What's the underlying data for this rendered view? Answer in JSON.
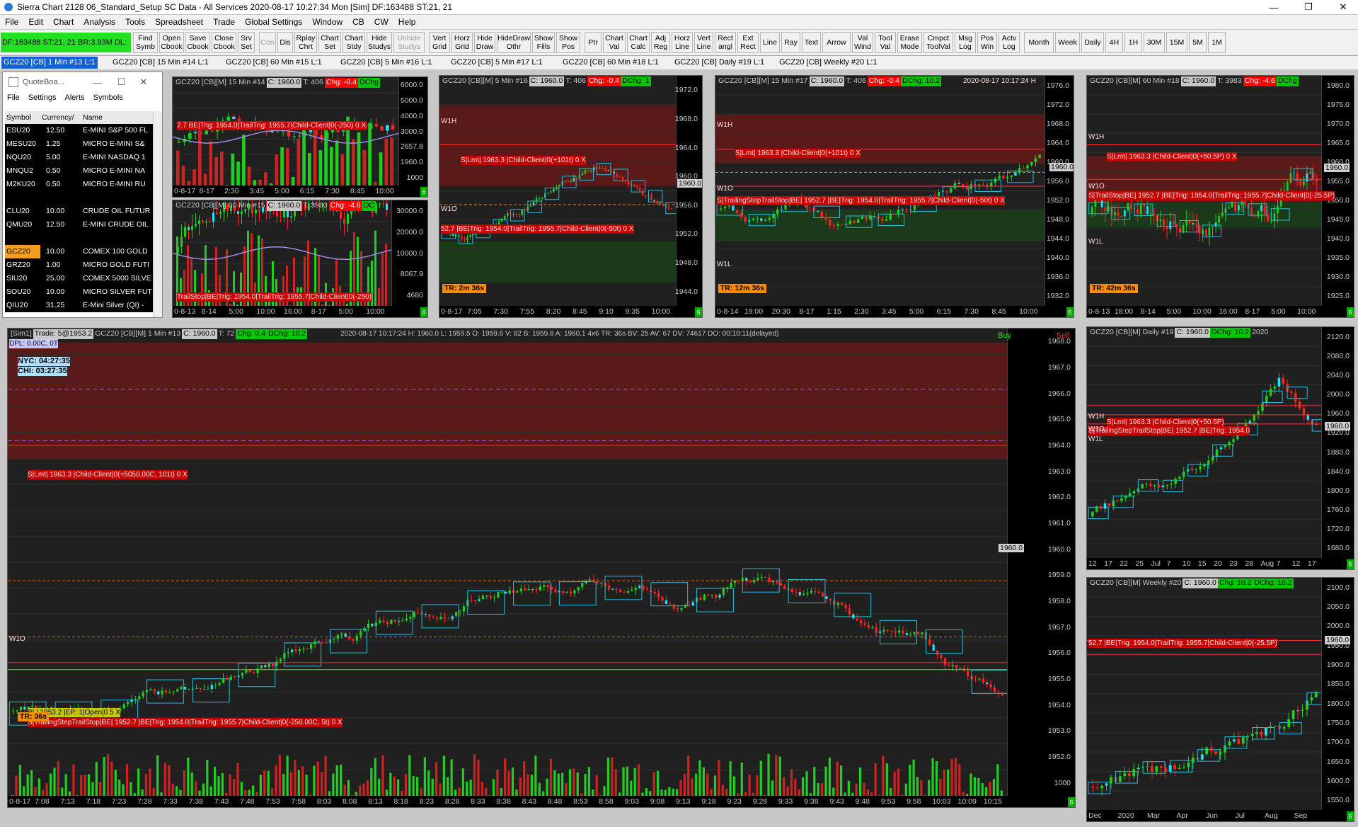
{
  "window": {
    "title": "Sierra Chart 2128 06_Standard_Setup  SC Data - All Services 2020-08-17  10:27:34 Mon [Sim]  DF:163488  ST:21, 21",
    "minimize": "—",
    "restore": "❐",
    "close": "✕"
  },
  "menu": [
    "File",
    "Edit",
    "Chart",
    "Analysis",
    "Tools",
    "Spreadsheet",
    "Trade",
    "Global Settings",
    "Window",
    "CB",
    "CW",
    "Help"
  ],
  "toolbar": {
    "status": "DF:163488  ST:21, 21  BR:3.93M  DL:",
    "buttons": [
      {
        "label": "Find\nSymb"
      },
      {
        "label": "Open\nCbook"
      },
      {
        "label": "Save\nCbook"
      },
      {
        "label": "Close\nCbook"
      },
      {
        "label": "Srv\nSet"
      },
      {
        "label": "Con",
        "disabled": true
      },
      {
        "label": "Dis"
      },
      {
        "label": "Rplay\nChrt"
      },
      {
        "label": "Chart\nSet"
      },
      {
        "label": "Chart\nStdy"
      },
      {
        "label": "Hide\nStudys"
      },
      {
        "label": "Unhide\nStudys",
        "disabled": true
      },
      {
        "label": "Vert\nGrid"
      },
      {
        "label": "Horz\nGrid"
      },
      {
        "label": "Hide\nDraw"
      },
      {
        "label": "HideDraw\nOthr"
      },
      {
        "label": "Show\nFills"
      },
      {
        "label": "Show\nPos"
      },
      {
        "label": "Ptr"
      },
      {
        "label": "Chart\nVal"
      },
      {
        "label": "Chart\nCalc"
      },
      {
        "label": "Adj\nReg"
      },
      {
        "label": "Horz\nLine"
      },
      {
        "label": "Vert\nLine"
      },
      {
        "label": "Rect\nangl"
      },
      {
        "label": "Ext\nRect"
      },
      {
        "label": "Line"
      },
      {
        "label": "Ray"
      },
      {
        "label": "Text"
      },
      {
        "label": "Arrow"
      },
      {
        "label": "Val\nWind"
      },
      {
        "label": "Tool\nVal"
      },
      {
        "label": "Erase\nMode"
      },
      {
        "label": "Cmpct\nToolVal"
      },
      {
        "label": "Msg\nLog"
      },
      {
        "label": "Pos\nWin"
      },
      {
        "label": "Actv\nLog"
      },
      {
        "label": "Month"
      },
      {
        "label": "Week"
      },
      {
        "label": "Daily"
      },
      {
        "label": "4H"
      },
      {
        "label": "1H"
      },
      {
        "label": "30M"
      },
      {
        "label": "15M"
      },
      {
        "label": "5M"
      },
      {
        "label": "1M"
      }
    ]
  },
  "tabs": [
    "GCZ20 [CB]  1 Min  #13  L:1",
    "GCZ20 [CB]  15 Min  #14  L:1",
    "GCZ20 [CB]  60 Min  #15  L:1",
    "GCZ20 [CB]  5 Min  #16  L:1",
    "GCZ20 [CB]  5 Min  #17  L:1",
    "GCZ20 [CB]  60 Min  #18  L:1",
    "GCZ20 [CB]  Daily  #19  L:1",
    "GCZ20 [CB]  Weekly  #20  L:1"
  ],
  "quoteboard": {
    "title": "QuoteBoa...",
    "menu": [
      "File",
      "Settings",
      "Alerts",
      "Symbols"
    ],
    "headers": [
      "Symbol",
      "Currency/",
      "Name"
    ],
    "rows": [
      [
        "ESU20",
        "12.50",
        "E-MINI S&P 500 FL"
      ],
      [
        "MESU20",
        "1.25",
        "MICRO E-MINI S&"
      ],
      [
        "NQU20",
        "5.00",
        "E-MINI NASDAQ 1"
      ],
      [
        "MNQU2",
        "0.50",
        "MICRO E-MINI NA"
      ],
      [
        "M2KU20",
        "0.50",
        "MICRO E-MINI RU"
      ],
      [
        "",
        "",
        " "
      ],
      [
        "CLU20",
        "10.00",
        "CRUDE OIL FUTUR"
      ],
      [
        "QMU20",
        "12.50",
        "E-MINI CRUDE OIL"
      ],
      [
        "",
        "",
        " "
      ],
      [
        "GCZ20",
        "10.00",
        "COMEX 100 GOLD"
      ],
      [
        "GRZ20",
        "1.00",
        "MICRO GOLD FUTI"
      ],
      [
        "SIU20",
        "25.00",
        "COMEX 5000 SILVE"
      ],
      [
        "SOU20",
        "10.00",
        "MICRO SILVER FUT"
      ],
      [
        "QIU20",
        "31.25",
        "E-Mini Silver (QI) -"
      ]
    ]
  },
  "charts": {
    "c14": {
      "header": [
        "GCZ20 [CB][M]  15 Min  #14",
        "C: 1960.0",
        "T: 406",
        "Chg: -0.4",
        "DChg"
      ],
      "yticks": [
        "6000.0",
        "5000.0",
        "4000.0",
        "3000.0",
        "2657.8",
        "1960.0",
        "1000"
      ],
      "xticks": [
        "0-8-17",
        "8-17",
        "2:30",
        "3:45",
        "5:00",
        "6:15",
        "7:30",
        "8:45",
        "10:00"
      ],
      "order": "2.7 BE|Trig: 1954.0|TrailTrig: 1955.7|Child-Client|0(-250)  0  X",
      "cur": "1960.0"
    },
    "c15": {
      "header": [
        "GCZ20 [CB][M]  60 Min  #15",
        "C: 1960.0",
        "T: 3983",
        "Chg: -4.6",
        "DC"
      ],
      "yticks": [
        "30000.0",
        "20000.0",
        "10000.0",
        "8067.9",
        "4680"
      ],
      "xticks": [
        "0-8-13",
        "8-14",
        "5:00",
        "10:00",
        "16:00",
        "8-17",
        "5:00",
        "10:00"
      ],
      "order": "TrailStop|BE|Trig: 1954.0|TrailTrig: 1955.7|Child-Client|0(-250)"
    },
    "c16": {
      "header": [
        "GCZ20 [CB][M]  5 Min  #16",
        "C: 1960.0",
        "T: 406",
        "Chg: -0.4",
        "DChg: 1"
      ],
      "yticks": [
        "1972.0",
        "1968.0",
        "1964.0",
        "1960.0",
        "1956.0",
        "1952.0",
        "1948.0",
        "1944.0"
      ],
      "xticks": [
        "0-8-17",
        "7:05",
        "7:30",
        "7:55",
        "8:20",
        "8:45",
        "9:10",
        "9:35",
        "10:00"
      ],
      "order1": "S|Lmt| 1963.3 |Child-Client|0(+101t)  0  X",
      "order2": "52.7 |BE|Trig: 1954.0|TrailTrig: 1955.7|Child-Client|0(-50t)  0  X",
      "w1h": "W1H",
      "w1o": "W1O",
      "badge": "TR: 2m 36s",
      "cur": "1960.0"
    },
    "c17": {
      "header": [
        "GCZ20 [CB][M]  15 Min  #17",
        "C: 1960.0",
        "T: 406",
        "Chg: -0.4",
        "DChg: 10.2"
      ],
      "ts": "2020-08-17 10:17:24 H",
      "yticks": [
        "1976.0",
        "1972.0",
        "1968.0",
        "1964.0",
        "1960.0",
        "1956.0",
        "1952.0",
        "1948.0",
        "1944.0",
        "1940.0",
        "1936.0",
        "1932.0"
      ],
      "xticks": [
        "0-8-14",
        "19:00",
        "20:30",
        "8-17",
        "1:15",
        "2:30",
        "3:45",
        "5:00",
        "6:15",
        "7:30",
        "8:45",
        "10:00"
      ],
      "order1": "S|Lmt| 1963.3 |Child-Client|0(+101t)  0  X",
      "order2": "S|TrailingStepTrailStop|BE| 1952.7 |BE|Trig: 1954.0|TrailTrig: 1955.7|Child-Client|0(-50t)  0  X",
      "w1h": "W1H",
      "w1o": "W1O",
      "w1l": "W1L",
      "badge": "TR: 12m 36s",
      "cur": "1960.0"
    },
    "c18": {
      "header": [
        "GCZ20 [CB][M]  60 Min  #18",
        "C: 1960.0",
        "T: 3983",
        "Chg: -4.6",
        "DChg"
      ],
      "yticks": [
        "1980.0",
        "1975.0",
        "1970.0",
        "1965.0",
        "1960.0",
        "1955.0",
        "1950.0",
        "1945.0",
        "1940.0",
        "1935.0",
        "1930.0",
        "1925.0"
      ],
      "xticks": [
        "0-8-13",
        "18:00",
        "8-14",
        "5:00",
        "10:00",
        "16:00",
        "8-17",
        "5:00",
        "10:00"
      ],
      "order1": "S|Lmt| 1963.3 |Child-Client|0(+50.5P)  0  X",
      "order2": "S|TrailStop|BE| 1952.7 |BE|Trig: 1954.0|TrailTrig: 1955.7|Child-Client|0(-25.5P)",
      "w1h": "W1H",
      "w1o": "W1O",
      "w1l": "W1L",
      "badge": "TR: 42m 36s",
      "cur": "1960.0"
    },
    "c13": {
      "header": [
        "[Sim1]",
        "Trade: 5@1953.2",
        "GCZ20 [CB][M]  1 Min  #13",
        "C: 1960.0",
        "T: 72",
        "Chg: 0.4",
        "DChg: 10.2"
      ],
      "info": "2020-08-17 10:17:24  H: 1960.0  L: 1959.5  O: 1959.6  V: 82  B: 1959.8  A: 1960.1  4x6  TR: 36s  BV: 25  AV: 67  DV: 74617  DO: 00:10:11(delayed)",
      "dpl": "DPL: 0.00C, 0T",
      "nyc": "NYC: 04:27:35",
      "chi": "CHI: 03:27:35",
      "buy": "Buy",
      "sell": "Sell",
      "yticks": [
        "1968.0",
        "1967.0",
        "1966.0",
        "1965.0",
        "1964.0",
        "1963.0",
        "1962.0",
        "1961.0",
        "1960.0",
        "1959.0",
        "1958.0",
        "1957.0",
        "1956.0",
        "1955.0",
        "1954.0",
        "1953.0",
        "1952.0",
        "1000"
      ],
      "xticks": [
        "0-8-17",
        "7:08",
        "7:13",
        "7:18",
        "7:23",
        "7:28",
        "7:33",
        "7:38",
        "7:43",
        "7:48",
        "7:53",
        "7:58",
        "8:03",
        "8:08",
        "8:13",
        "8:18",
        "8:23",
        "8:28",
        "8:33",
        "8:38",
        "8:43",
        "8:48",
        "8:53",
        "8:58",
        "9:03",
        "9:08",
        "9:13",
        "9:18",
        "9:23",
        "9:28",
        "9:33",
        "9:38",
        "9:43",
        "9:48",
        "9:53",
        "9:58",
        "10:03",
        "10:09",
        "10:15"
      ],
      "order1": "S|Lmt| 1963.3 |Child-Client|0(+5050.00C, 101t)  0  X",
      "order2": "S|TrailingStepTrailStop|BE| 1952.7 |BE|Trig: 1954.0|TrailTrig: 1955.7|Child-Client|0(-250.00C, 5t)  0  X",
      "pos": "BL| 1953.2 |EP: 1|Open|0  5  X",
      "w1o": "W1O",
      "badge": "TR: 36s",
      "cur": "1960.0"
    },
    "c19": {
      "header": [
        "GCZ20 [CB][M]  Daily  #19",
        "C: 1960.0",
        "DChg: 10.2",
        "2020"
      ],
      "yticks": [
        "2120.0",
        "2080.0",
        "2040.0",
        "2000.0",
        "1960.0",
        "1920.0",
        "1880.0",
        "1840.0",
        "1800.0",
        "1760.0",
        "1720.0",
        "1680.0"
      ],
      "xticks": [
        "12",
        "17",
        "22",
        "25",
        "Jul",
        "7",
        "10",
        "15",
        "20",
        "23",
        "28",
        "Aug",
        "7",
        "12",
        "17"
      ],
      "order1": "S|Lmt| 1963.3 |Child-Client|0(+50.5P)",
      "order2": "S|TrailingStepTrailStop|BE| 1952.7 |BE|Trig: 1954.0",
      "w1h": "W1H",
      "w1o": "W1O",
      "w1l": "W1L",
      "cur": "1960.0"
    },
    "c20": {
      "header": [
        "GCZ20 [CB][M]  Weekly  #20",
        "C: 1960.0",
        "Chg: 10.2",
        "DChg: 10.2"
      ],
      "yticks": [
        "2100.0",
        "2050.0",
        "2000.0",
        "1950.0",
        "1900.0",
        "1850.0",
        "1800.0",
        "1750.0",
        "1700.0",
        "1650.0",
        "1600.0",
        "1550.0"
      ],
      "xticks": [
        "Dec",
        "2020",
        "Mar",
        "Apr",
        "Jun",
        "Jul",
        "Aug",
        "Sep"
      ],
      "order": "52.7 |BE|Trig: 1954.0|TrailTrig: 1955.7|Child-Client|0(-25.5P)",
      "cur": "1960.0"
    }
  },
  "colors": {
    "accent": "#1060d8",
    "status_green": "#22e022",
    "buy_green": "#00c800",
    "sell_red": "#ff0000",
    "candle_up": "#22cc22",
    "candle_down": "#ff2222",
    "candle_box": "#22e0ff",
    "zone_red": "#5a1a1a",
    "zone_green": "#1a3a1a"
  }
}
